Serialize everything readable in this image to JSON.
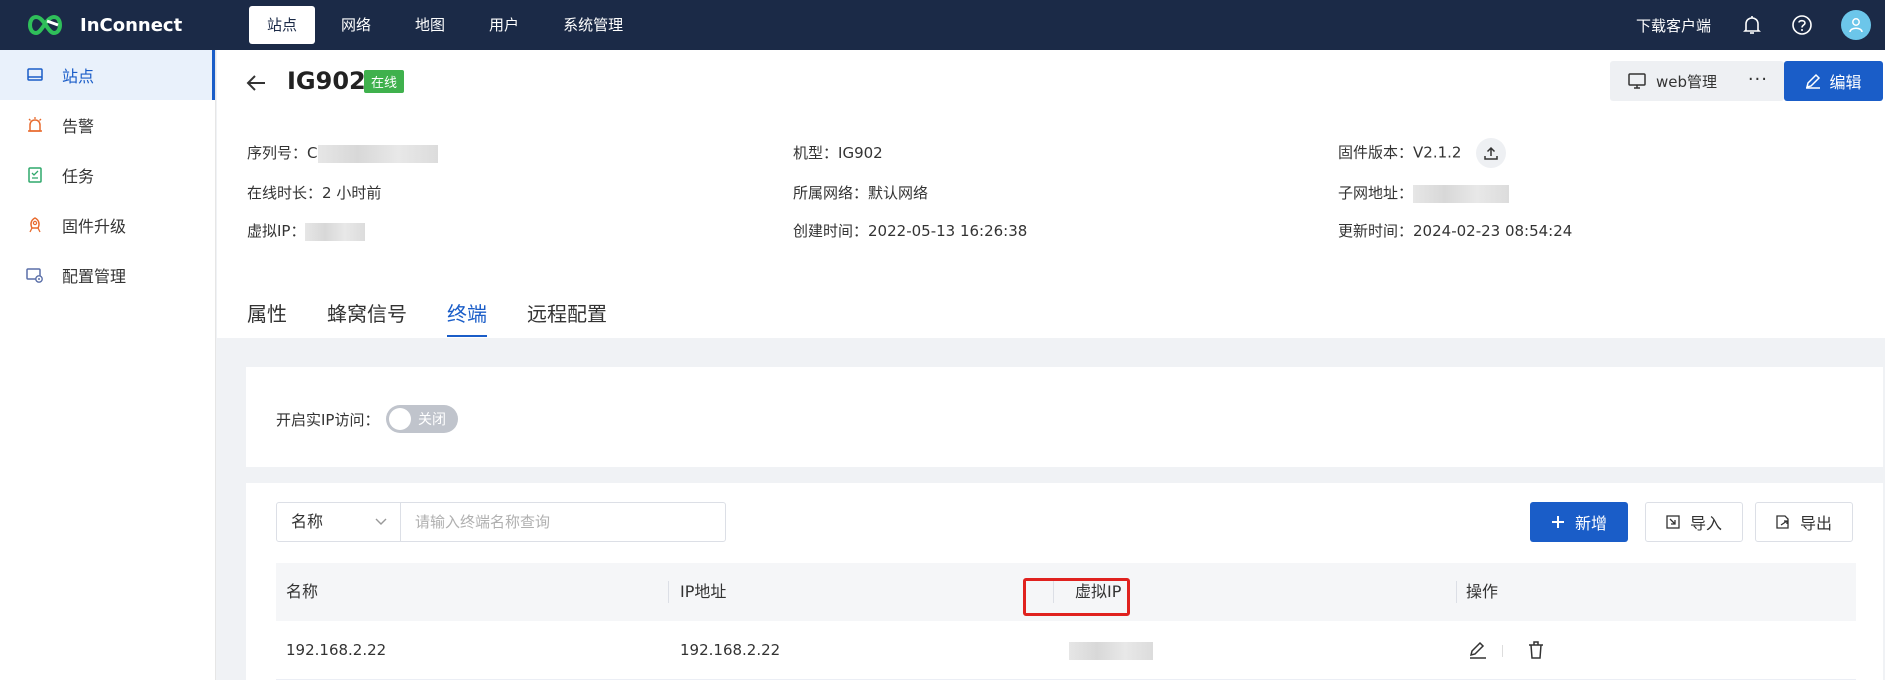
{
  "app": {
    "name": "InConnect",
    "brand_color": "#1b2a47",
    "accent_color": "#1a5dc8"
  },
  "topnav": {
    "items": [
      {
        "label": "站点",
        "active": true
      },
      {
        "label": "网络",
        "active": false
      },
      {
        "label": "地图",
        "active": false
      },
      {
        "label": "用户",
        "active": false
      },
      {
        "label": "系统管理",
        "active": false
      }
    ],
    "download_label": "下载客户端",
    "icons": [
      "bell-icon",
      "help-icon",
      "user-avatar-icon"
    ]
  },
  "sidebar": {
    "items": [
      {
        "label": "站点",
        "icon": "site-icon",
        "active": true
      },
      {
        "label": "告警",
        "icon": "alarm-icon",
        "active": false
      },
      {
        "label": "任务",
        "icon": "task-icon",
        "active": false
      },
      {
        "label": "固件升级",
        "icon": "firmware-icon",
        "active": false
      },
      {
        "label": "配置管理",
        "icon": "config-icon",
        "active": false
      }
    ]
  },
  "device": {
    "name": "IG902",
    "status": "在线",
    "status_color": "#3fb14d",
    "web_manage_label": "web管理",
    "more_label": "···",
    "edit_label": "编辑",
    "info": {
      "serial_label": "序列号：",
      "serial_prefix": "C",
      "model_label": "机型：",
      "model_value": "IG902",
      "firmware_label": "固件版本：",
      "firmware_value": "V2.1.2",
      "uptime_label": "在线时长：",
      "uptime_value": "2 小时前",
      "network_label": "所属网络：",
      "network_value": "默认网络",
      "subnet_label": "子网地址：",
      "vip_label": "虚拟IP：",
      "created_label": "创建时间：",
      "created_value": "2022-05-13 16:26:38",
      "updated_label": "更新时间：",
      "updated_value": "2024-02-23 08:54:24"
    }
  },
  "tabs": [
    {
      "label": "属性",
      "active": false
    },
    {
      "label": "蜂窝信号",
      "active": false
    },
    {
      "label": "终端",
      "active": true
    },
    {
      "label": "远程配置",
      "active": false
    }
  ],
  "real_ip": {
    "label": "开启实IP访问：",
    "switch_label": "关闭",
    "enabled": false
  },
  "terminal": {
    "search": {
      "field_selected": "名称",
      "placeholder": "请输入终端名称查询"
    },
    "add_label": "新增",
    "import_label": "导入",
    "export_label": "导出",
    "columns": [
      "名称",
      "IP地址",
      "虚拟IP",
      "操作"
    ],
    "rows": [
      {
        "name": "192.168.2.22",
        "ip": "192.168.2.22"
      }
    ]
  }
}
